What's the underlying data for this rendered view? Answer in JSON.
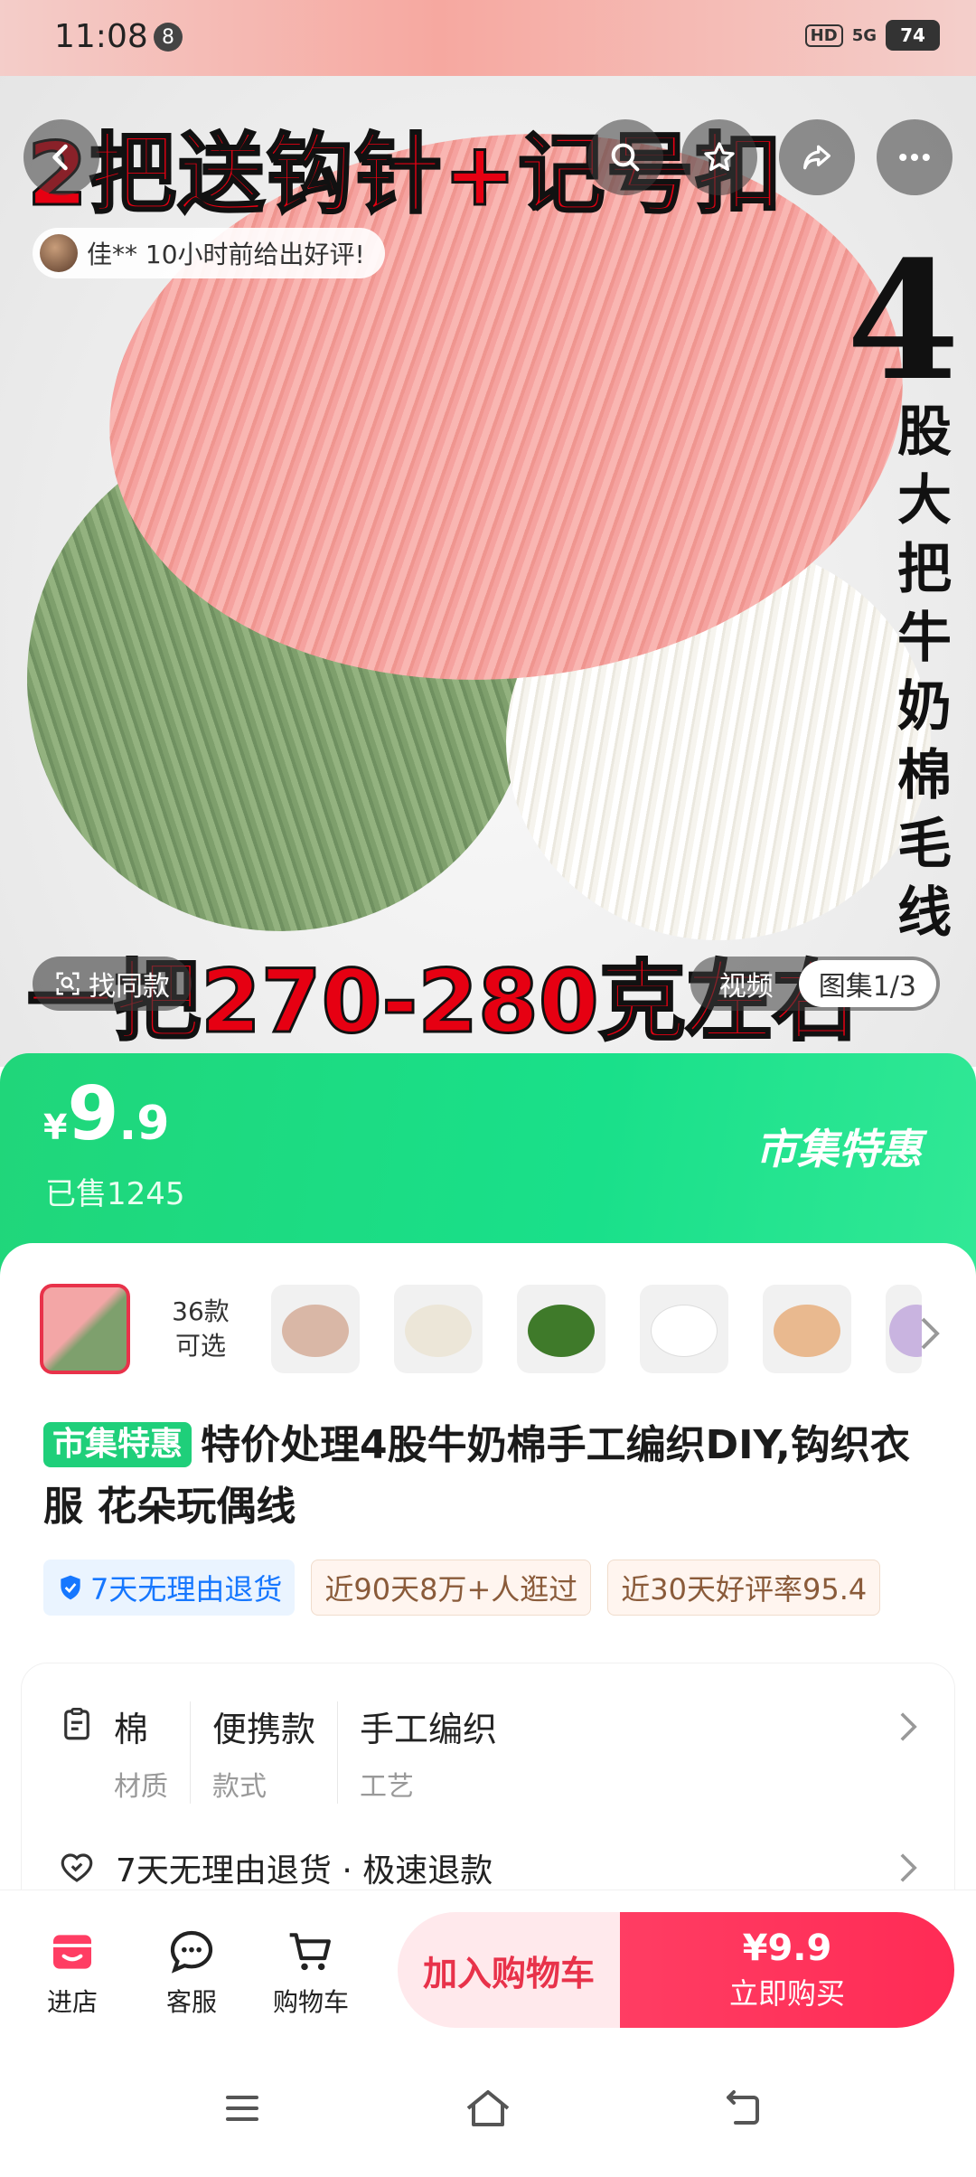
{
  "status_bar": {
    "time": "11:08",
    "notification_count": "8",
    "hd": "HD",
    "network": "5G",
    "battery": "74"
  },
  "hero": {
    "overlay_top": "2把送钩针+记号扣",
    "overlay_four": "4",
    "overlay_vertical": "股大把牛奶棉毛线",
    "overlay_bottom": "一把270-280克左右",
    "review_chip": "佳** 10小时前给出好评!",
    "find_same": "找同款",
    "media_video": "视频",
    "media_album": "图集1/3"
  },
  "price": {
    "currency": "¥",
    "integer": "9",
    "decimal": ".9",
    "sold": "已售1245",
    "promo_tag": "市集特惠"
  },
  "variants": {
    "count_line1": "36款",
    "count_line2": "可选",
    "thumb_colors": [
      "#d9b7a6",
      "#ece6d8",
      "#3f7a2a",
      "#f2f2f2",
      "#e9b98f",
      "#c9b4e0"
    ]
  },
  "product": {
    "tag": "市集特惠",
    "title": "特价处理4股牛奶棉手工编织DIY,钩织衣服 花朵玩偶线"
  },
  "chips": [
    {
      "label": "7天无理由退货",
      "style": "blue"
    },
    {
      "label": "近90天8万+人逛过",
      "style": "tan"
    },
    {
      "label": "近30天好评率95.4",
      "style": "tan"
    }
  ],
  "attributes": [
    {
      "value": "棉",
      "label": "材质"
    },
    {
      "value": "便携款",
      "label": "款式"
    },
    {
      "value": "手工编织",
      "label": "工艺"
    }
  ],
  "return_policy": "7天无理由退货 · 极速退款",
  "actions": {
    "shop": "进店",
    "service": "客服",
    "cart": "购物车",
    "add_to_cart": "加入购物车",
    "buy_price": "¥9.9",
    "buy_now": "立即购买"
  },
  "colors": {
    "accent_green": "#1fcf7a",
    "accent_red": "#ff2b55",
    "overlay_red": "#e60012"
  }
}
